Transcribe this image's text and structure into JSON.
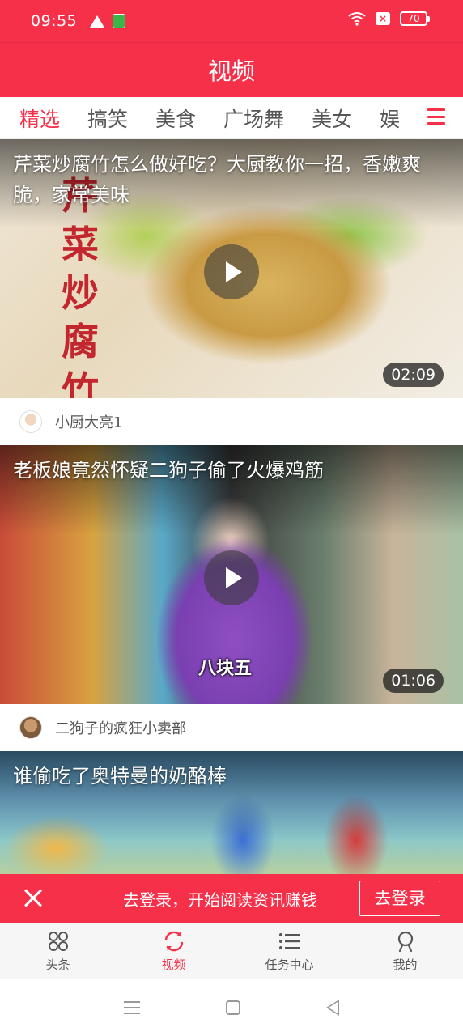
{
  "status_bar": {
    "time": "09:55",
    "battery": "70",
    "icons": [
      "warning-icon",
      "app-notification-icon",
      "wifi-icon",
      "no-sim-icon",
      "battery-icon"
    ]
  },
  "header": {
    "title": "视频"
  },
  "tabs": [
    {
      "label": "精选",
      "active": true
    },
    {
      "label": "搞笑",
      "active": false
    },
    {
      "label": "美食",
      "active": false
    },
    {
      "label": "广场舞",
      "active": false
    },
    {
      "label": "美女",
      "active": false
    },
    {
      "label": "娱",
      "active": false
    }
  ],
  "videos": [
    {
      "title": "芹菜炒腐竹怎么做好吃？大厨教你一招，香嫩爽脆，家常美味",
      "duration": "02:09",
      "author": "小厨大亮1",
      "thumb_text": "芹菜炒腐竹"
    },
    {
      "title": "老板娘竟然怀疑二狗子偷了火爆鸡筋",
      "duration": "01:06",
      "author": "二狗子的疯狂小卖部",
      "thumb_text": "八块五"
    },
    {
      "title": "谁偷吃了奥特曼的奶酪棒"
    }
  ],
  "login_banner": {
    "text": "去登录，开始阅读资讯赚钱",
    "button": "去登录"
  },
  "bottom_nav": [
    {
      "label": "头条",
      "icon": "grid-icon",
      "active": false
    },
    {
      "label": "视频",
      "icon": "refresh-icon",
      "active": true
    },
    {
      "label": "任务中心",
      "icon": "list-icon",
      "active": false
    },
    {
      "label": "我的",
      "icon": "person-icon",
      "active": false
    }
  ],
  "colors": {
    "brand": "#f7304a"
  }
}
